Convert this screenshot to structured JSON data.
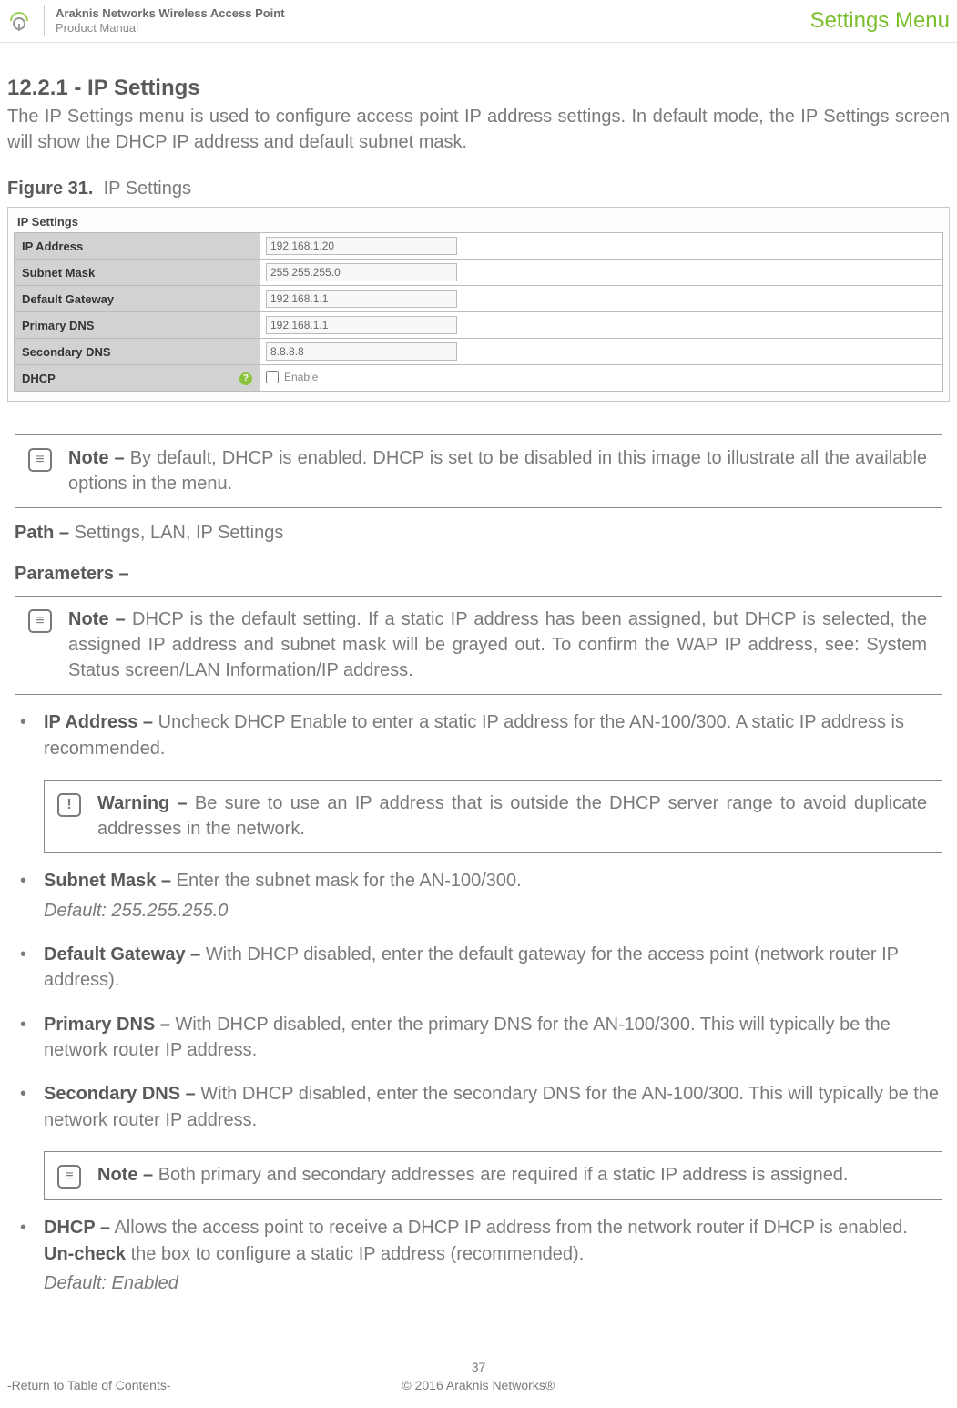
{
  "header": {
    "product": "Araknis Networks Wireless Access Point",
    "subtitle": "Product Manual",
    "menu": "Settings Menu"
  },
  "section": {
    "number": "12.2.1 - IP Settings",
    "intro": "The IP Settings menu is used to configure access point IP address settings. In default mode, the IP Settings screen will show the DHCP IP address and default subnet mask."
  },
  "figure": {
    "label": "Figure 31.",
    "title": "IP Settings"
  },
  "ip_settings": {
    "title": "IP Settings",
    "rows": {
      "ip_address_label": "IP Address",
      "ip_address_value": "192.168.1.20",
      "subnet_label": "Subnet Mask",
      "subnet_value": "255.255.255.0",
      "gateway_label": "Default Gateway",
      "gateway_value": "192.168.1.1",
      "pdns_label": "Primary DNS",
      "pdns_value": "192.168.1.1",
      "sdns_label": "Secondary DNS",
      "sdns_value": "8.8.8.8",
      "dhcp_label": "DHCP",
      "dhcp_cb_label": "Enable"
    }
  },
  "note1": {
    "label": "Note –",
    "text": "By default, DHCP is enabled. DHCP is set to be disabled in this image to illustrate all the available options in the menu."
  },
  "path": {
    "label": "Path –",
    "value": "Settings, LAN, IP Settings"
  },
  "params_heading": "Parameters –",
  "note2": {
    "label": "Note –",
    "text": "DHCP is the default setting. If a static IP address has been assigned, but DHCP is selected, the assigned IP address and subnet mask will be grayed out. To confirm the WAP IP address, see: System Status screen/LAN Information/IP address."
  },
  "params": {
    "ip_label": "IP Address –",
    "ip_text": "Uncheck DHCP Enable to enter a static IP address for the AN-100/300. A static IP address is recommended.",
    "subnet_label": "Subnet Mask –",
    "subnet_text": "Enter the subnet mask for the AN-100/300.",
    "subnet_default": "Default: 255.255.255.0",
    "gateway_label": "Default Gateway –",
    "gateway_text": "With DHCP disabled, enter the default gateway for the access point (network router IP address).",
    "pdns_label": "Primary DNS –",
    "pdns_text": "With DHCP disabled, enter the primary DNS for the AN-100/300. This will typically be the network router IP address.",
    "sdns_label": "Secondary DNS –",
    "sdns_text": "With DHCP disabled, enter the secondary DNS for the AN-100/300. This will typically be the network router IP address.",
    "dhcp_label": "DHCP –",
    "dhcp_text_a": "Allows the access point to receive a DHCP IP address from the network router if DHCP is enabled. ",
    "dhcp_bold": "Un-check",
    "dhcp_text_b": " the box to configure a static IP address (recommended).",
    "dhcp_default": "Default: Enabled"
  },
  "warning": {
    "label": "Warning –",
    "text": "Be sure to use an IP address that is outside the DHCP server range to avoid duplicate addresses in the network."
  },
  "note3": {
    "label": "Note –",
    "text": "Both primary and secondary addresses are required if a static IP address is assigned."
  },
  "footer": {
    "page": "37",
    "toc": "-Return to Table of Contents-",
    "copyright": "© 2016 Araknis Networks®"
  }
}
